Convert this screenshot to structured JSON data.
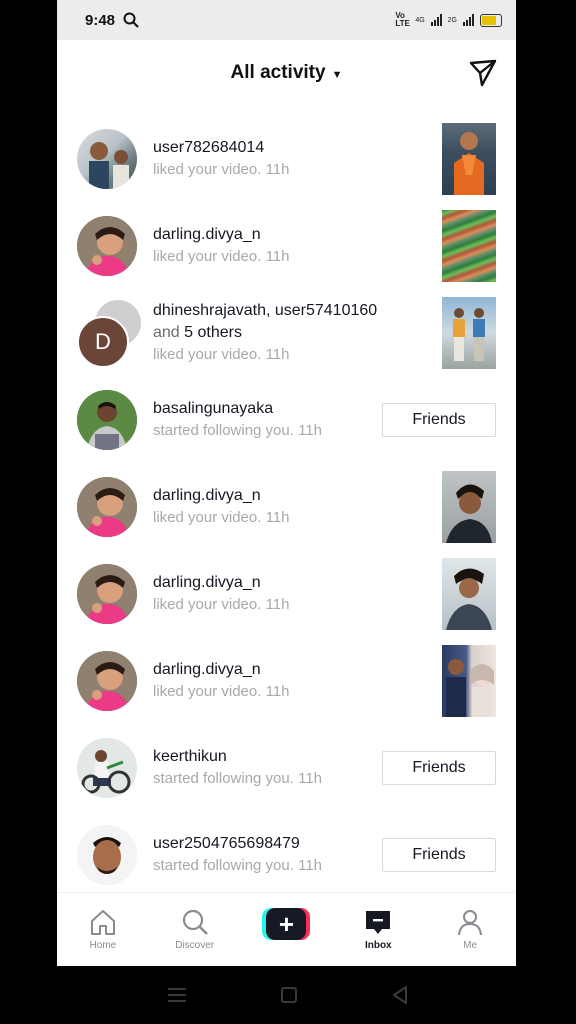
{
  "status": {
    "time": "9:48",
    "network1": "4G",
    "network2": "2G",
    "volte": "Vo LTE"
  },
  "header": {
    "title": "All activity"
  },
  "activities": [
    {
      "user": "user782684014",
      "action": "liked your video.",
      "time": "11h"
    },
    {
      "user": "darling.divya_n",
      "action": "liked your video.",
      "time": "11h"
    },
    {
      "user": "dhineshrajavath, user57410160",
      "and_text": "and",
      "others": "5 others",
      "action": "liked your video.",
      "time": "11h",
      "initial": "D"
    },
    {
      "user": "basalingunayaka",
      "action": "started following you.",
      "time": "11h",
      "button": "Friends"
    },
    {
      "user": "darling.divya_n",
      "action": "liked your video.",
      "time": "11h"
    },
    {
      "user": "darling.divya_n",
      "action": "liked your video.",
      "time": "11h"
    },
    {
      "user": "darling.divya_n",
      "action": "liked your video.",
      "time": "11h"
    },
    {
      "user": "keerthikun",
      "action": "started following you.",
      "time": "11h",
      "button": "Friends"
    },
    {
      "user": "user2504765698479",
      "action": "started following you.",
      "time": "11h",
      "button": "Friends"
    }
  ],
  "tabs": [
    {
      "label": "Home"
    },
    {
      "label": "Discover"
    },
    {
      "label": ""
    },
    {
      "label": "Inbox"
    },
    {
      "label": "Me"
    }
  ],
  "colors": {
    "accent_cyan": "#25f4ee",
    "accent_pink": "#fe2c55",
    "text_primary": "#161823",
    "text_secondary": "#a8a8ad"
  }
}
